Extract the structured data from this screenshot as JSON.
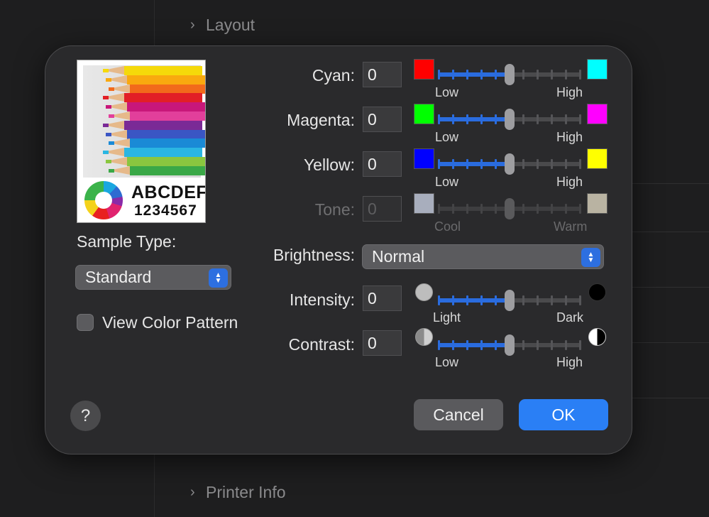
{
  "background": {
    "top_section": "Layout",
    "bottom_section": "Printer Info"
  },
  "dialog": {
    "preview": {
      "line1": "ABCDEF",
      "line2": "1234567"
    },
    "sample_type_label": "Sample Type:",
    "sample_type_value": "Standard",
    "view_color_pattern_label": "View Color Pattern",
    "view_color_pattern_checked": false,
    "sliders": [
      {
        "id": "cyan",
        "label": "Cyan:",
        "value": "0",
        "low": "Low",
        "high": "High",
        "left_color": "#ff0000",
        "right_color": "#00ffff",
        "enabled": true,
        "position": 0.5
      },
      {
        "id": "magenta",
        "label": "Magenta:",
        "value": "0",
        "low": "Low",
        "high": "High",
        "left_color": "#00ff00",
        "right_color": "#ff00ff",
        "enabled": true,
        "position": 0.5
      },
      {
        "id": "yellow",
        "label": "Yellow:",
        "value": "0",
        "low": "Low",
        "high": "High",
        "left_color": "#0000ff",
        "right_color": "#ffff00",
        "enabled": true,
        "position": 0.5
      },
      {
        "id": "tone",
        "label": "Tone:",
        "value": "0",
        "low": "Cool",
        "high": "Warm",
        "left_color": "#a8aebd",
        "right_color": "#b9b3a2",
        "enabled": false,
        "position": 0.5
      }
    ],
    "brightness_label": "Brightness:",
    "brightness_value": "Normal",
    "intensity": {
      "label": "Intensity:",
      "value": "0",
      "low": "Light",
      "high": "Dark",
      "position": 0.5
    },
    "contrast": {
      "label": "Contrast:",
      "value": "0",
      "low": "Low",
      "high": "High",
      "position": 0.5
    },
    "help_label": "?",
    "cancel_label": "Cancel",
    "ok_label": "OK"
  },
  "colors": {
    "accent": "#2a7ff5",
    "slider_fill": "#2a6cdf"
  }
}
